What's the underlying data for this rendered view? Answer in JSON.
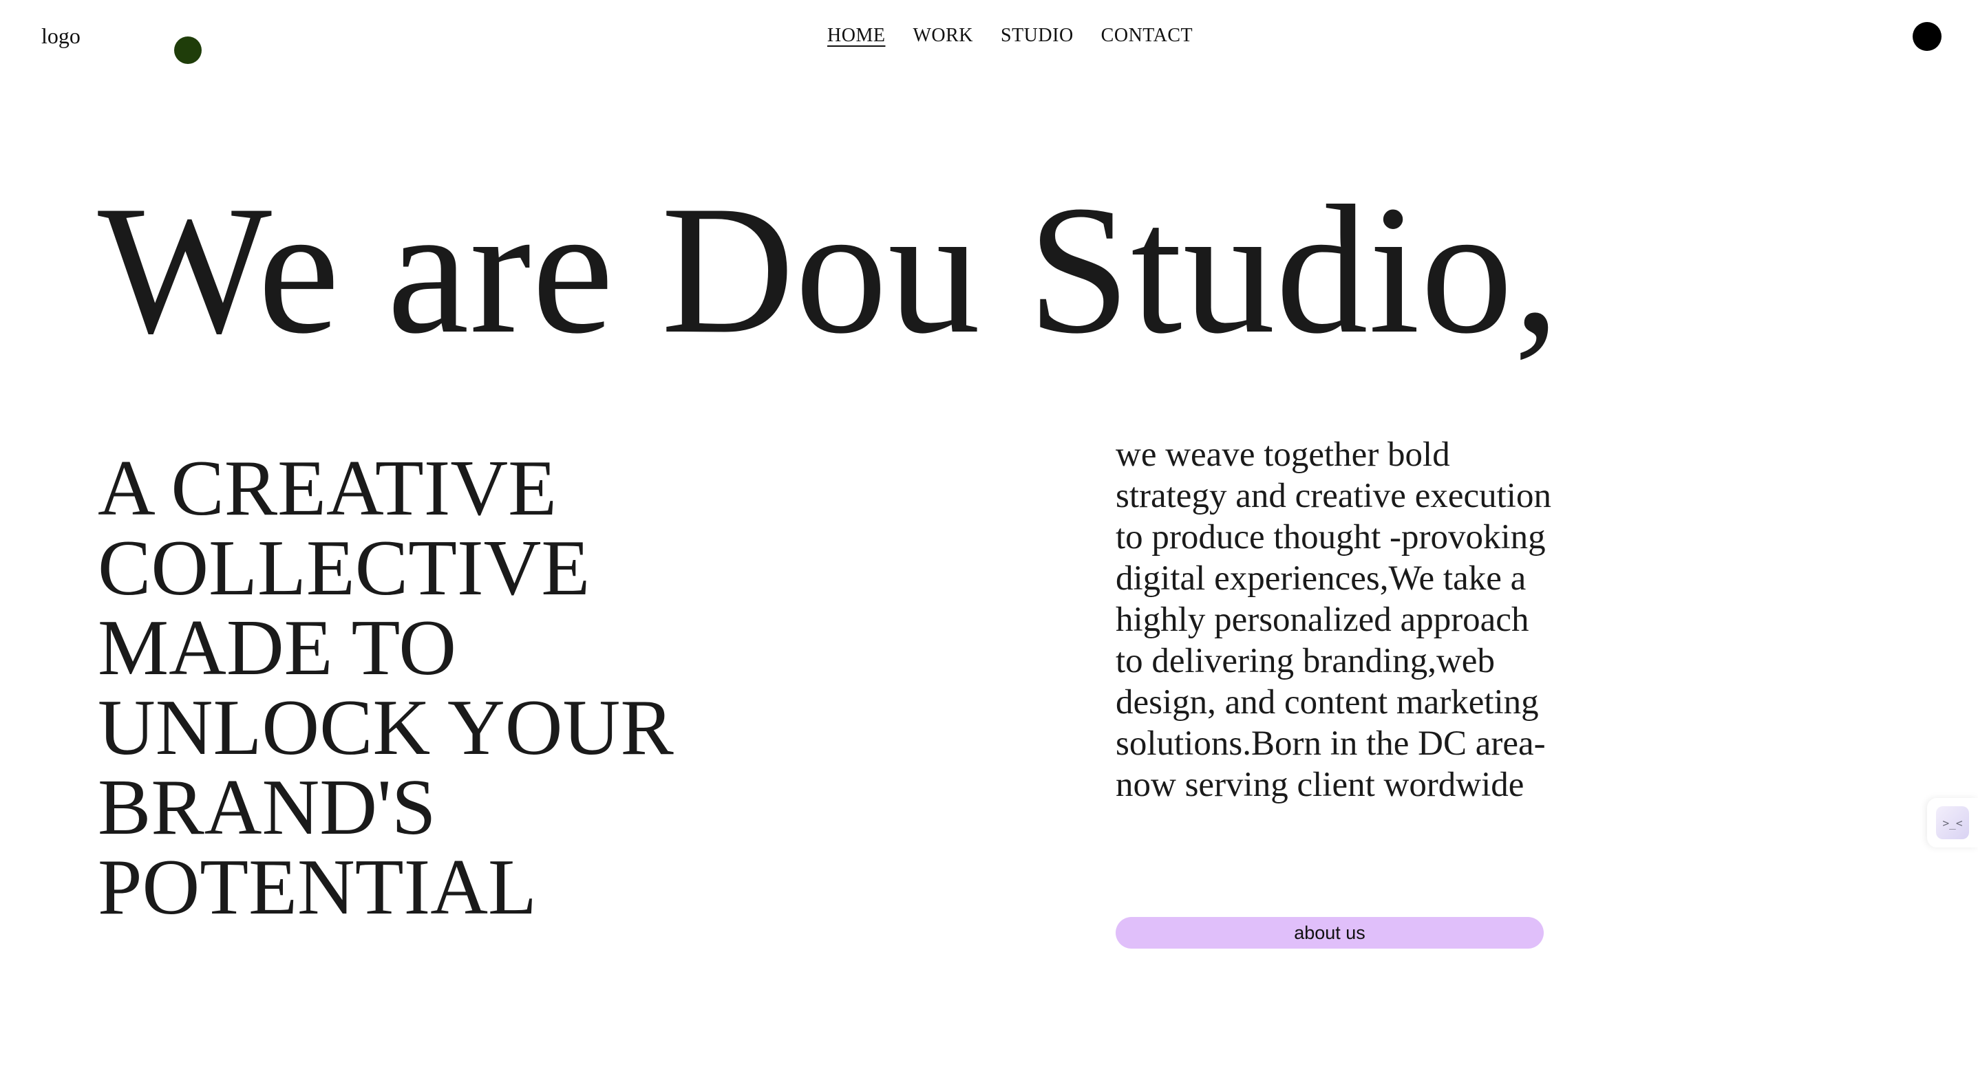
{
  "header": {
    "logo": "logo",
    "nav": [
      {
        "label": "HOME",
        "active": true
      },
      {
        "label": "WORK",
        "active": false
      },
      {
        "label": "STUDIO",
        "active": false
      },
      {
        "label": "CONTACT",
        "active": false
      }
    ]
  },
  "hero": {
    "title": "We are Dou Studio,",
    "tagline": "A CREATIVE COLLECTIVE MADE TO UNLOCK YOUR BRAND'S POTENTIAL",
    "description": "we weave together bold strategy and creative execution to produce thought -provoking digital experiences,We take a highly personalized approach to delivering branding,web design, and content marketing solutions.Born in the DC area-now serving client wordwide",
    "button_label": "about us"
  },
  "side_widget": {
    "icon": "code-face-icon",
    "glyph": ">_<"
  },
  "colors": {
    "accent_button": "#e0bffa",
    "green_dot": "#1f3d0a",
    "black_dot": "#000000",
    "text": "#1a1a1a",
    "background": "#ffffff"
  }
}
